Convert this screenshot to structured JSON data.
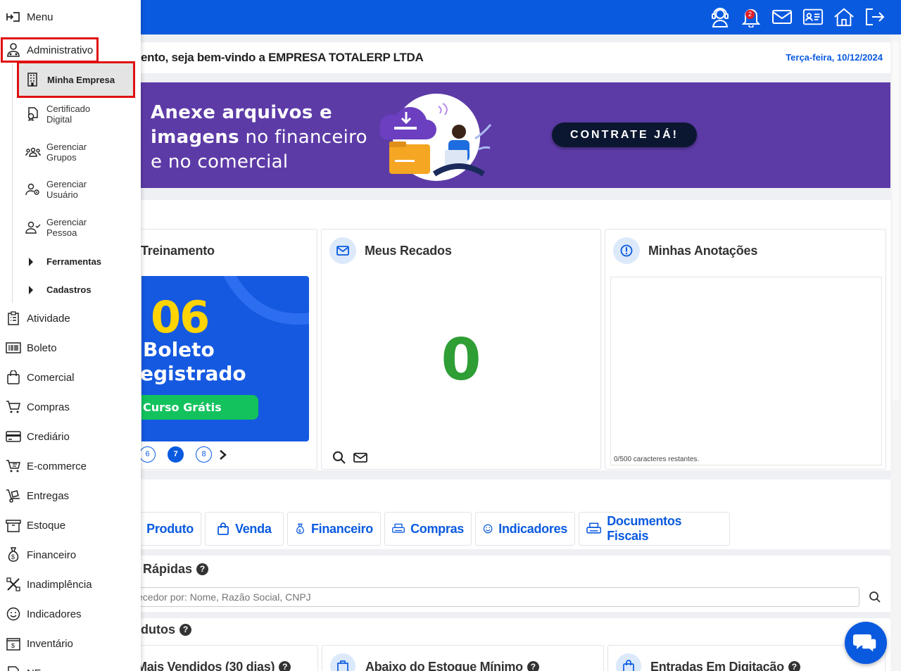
{
  "header": {
    "icons": [
      "support-agent-icon",
      "bell-icon",
      "mail-icon",
      "id-card-icon",
      "home-icon",
      "logout-icon"
    ],
    "notification_count": "2",
    "accent": "#0a5ae0"
  },
  "welcome": {
    "message": "ento, seja bem-vindo a EMPRESA TOTALERP LTDA",
    "date": "Terça-feira, 10/12/2024"
  },
  "banner": {
    "line1": "Anexe arquivos e",
    "line2_bold": "imagens",
    "line2_rest": " no financeiro",
    "line3": "e no comercial",
    "cta": "CONTRATE JÁ!"
  },
  "cards": {
    "training": {
      "title": "Treinamento",
      "number": "06",
      "line1": "Boleto",
      "line2": "egistrado",
      "button": "Curso Grátis",
      "pages": [
        "6",
        "7",
        "8"
      ],
      "active_page": "7"
    },
    "messages": {
      "title": "Meus Recados",
      "count": "0"
    },
    "notes": {
      "title": "Minhas Anotações",
      "counter": "0/500 caracteres restantes."
    }
  },
  "tabs": [
    {
      "label": "Produto",
      "icon": "arrow-up-icon"
    },
    {
      "label": "Venda",
      "icon": "shopping-bag-icon"
    },
    {
      "label": "Financeiro",
      "icon": "money-bag-icon"
    },
    {
      "label": "Compras",
      "icon": "printer-icon"
    },
    {
      "label": "Indicadores",
      "icon": "smile-icon"
    },
    {
      "label": "Documentos Fiscais",
      "icon": "printer-icon"
    }
  ],
  "quick": {
    "title": "Rápidas",
    "help": "?",
    "search_placeholder": "ecedor por: Nome, Razão Social, CNPJ"
  },
  "products": {
    "title": "dutos",
    "help": "?",
    "cards": [
      "Mais Vendidos (30 dias)",
      "Abaixo do Estoque Mínimo",
      "Entradas Em Digitação"
    ]
  },
  "sidebar": {
    "menu_label": "Menu",
    "admin_label": "Administrativo",
    "sub": {
      "minha_empresa": "Minha Empresa",
      "certificado_1": "Certificado",
      "certificado_2": "Digital",
      "grupos_1": "Gerenciar",
      "grupos_2": "Grupos",
      "usuario_1": "Gerenciar",
      "usuario_2": "Usuário",
      "pessoa_1": "Gerenciar",
      "pessoa_2": "Pessoa",
      "ferramentas": "Ferramentas",
      "cadastros": "Cadastros"
    },
    "items": [
      {
        "label": "Atividade",
        "icon": "clipboard-list-icon"
      },
      {
        "label": "Boleto",
        "icon": "barcode-icon"
      },
      {
        "label": "Comercial",
        "icon": "shopping-bag-icon"
      },
      {
        "label": "Compras",
        "icon": "cart-icon"
      },
      {
        "label": "Crediário",
        "icon": "credit-card-icon"
      },
      {
        "label": "E-commerce",
        "icon": "cart-icon"
      },
      {
        "label": "Entregas",
        "icon": "dolly-icon"
      },
      {
        "label": "Estoque",
        "icon": "box-icon"
      },
      {
        "label": "Financeiro",
        "icon": "money-bag-icon"
      },
      {
        "label": "Inadimplência",
        "icon": "tools-icon"
      },
      {
        "label": "Indicadores",
        "icon": "smile-icon"
      },
      {
        "label": "Inventário",
        "icon": "cash-register-icon"
      },
      {
        "label": "NF",
        "icon": "document-icon"
      }
    ]
  }
}
